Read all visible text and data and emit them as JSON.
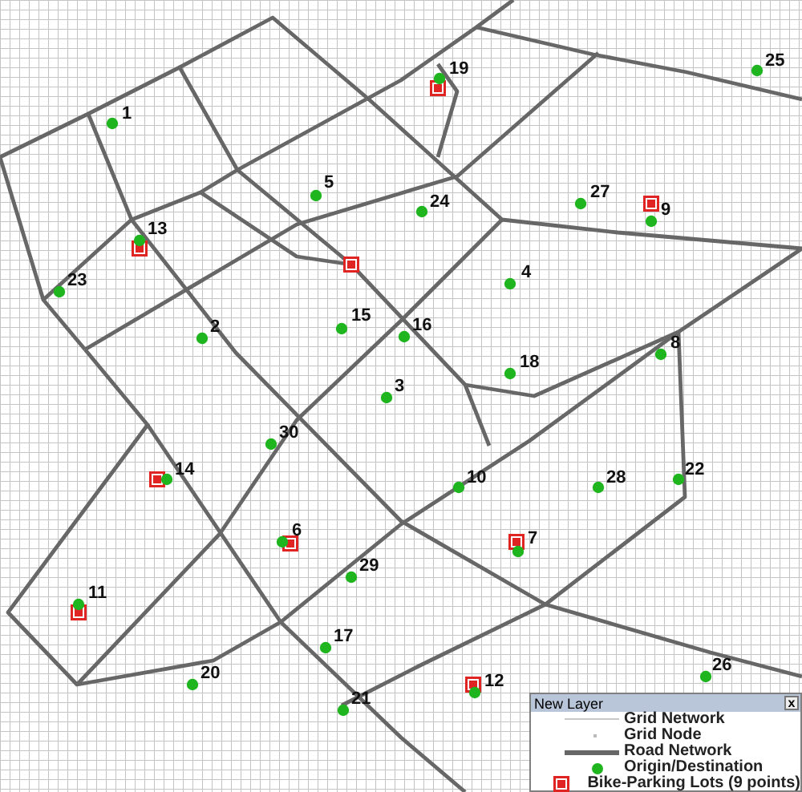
{
  "map": {
    "points": [
      {
        "kind": "od",
        "label": "1",
        "bike_parking": false
      },
      {
        "kind": "od",
        "label": "2",
        "bike_parking": false
      },
      {
        "kind": "od",
        "label": "3",
        "bike_parking": false
      },
      {
        "kind": "od",
        "label": "4",
        "bike_parking": false
      },
      {
        "kind": "od",
        "label": "5",
        "bike_parking": false
      },
      {
        "kind": "od",
        "label": "6",
        "bike_parking": true
      },
      {
        "kind": "od",
        "label": "7",
        "bike_parking": true
      },
      {
        "kind": "od",
        "label": "8",
        "bike_parking": false
      },
      {
        "kind": "od",
        "label": "9",
        "bike_parking": true
      },
      {
        "kind": "od",
        "label": "10",
        "bike_parking": false
      },
      {
        "kind": "od",
        "label": "11",
        "bike_parking": true
      },
      {
        "kind": "od",
        "label": "12",
        "bike_parking": true
      },
      {
        "kind": "od",
        "label": "13",
        "bike_parking": true
      },
      {
        "kind": "od",
        "label": "14",
        "bike_parking": true
      },
      {
        "kind": "od",
        "label": "15",
        "bike_parking": false
      },
      {
        "kind": "od",
        "label": "16",
        "bike_parking": false
      },
      {
        "kind": "od",
        "label": "17",
        "bike_parking": false
      },
      {
        "kind": "od",
        "label": "18",
        "bike_parking": false
      },
      {
        "kind": "od",
        "label": "19",
        "bike_parking": true
      },
      {
        "kind": "od",
        "label": "20",
        "bike_parking": false
      },
      {
        "kind": "od",
        "label": "21",
        "bike_parking": false
      },
      {
        "kind": "od",
        "label": "22",
        "bike_parking": false
      },
      {
        "kind": "od",
        "label": "23",
        "bike_parking": false
      },
      {
        "kind": "od",
        "label": "24",
        "bike_parking": false
      },
      {
        "kind": "od",
        "label": "25",
        "bike_parking": false
      },
      {
        "kind": "od",
        "label": "26",
        "bike_parking": false
      },
      {
        "kind": "od",
        "label": "27",
        "bike_parking": false
      },
      {
        "kind": "od",
        "label": "28",
        "bike_parking": false
      },
      {
        "kind": "od",
        "label": "29",
        "bike_parking": false
      },
      {
        "kind": "od",
        "label": "30",
        "bike_parking": false
      },
      {
        "kind": "lot",
        "bike_parking": true
      }
    ]
  },
  "legend": {
    "title": "New Layer",
    "close": "x",
    "items": [
      {
        "kind": "grid_line",
        "label": "Grid Network"
      },
      {
        "kind": "grid_node",
        "label": "Grid Node"
      },
      {
        "kind": "road",
        "label": "Road Network"
      },
      {
        "kind": "od",
        "label": "Origin/Destination"
      },
      {
        "kind": "lot",
        "label": "Bike-Parking Lots (9 points)"
      }
    ]
  }
}
